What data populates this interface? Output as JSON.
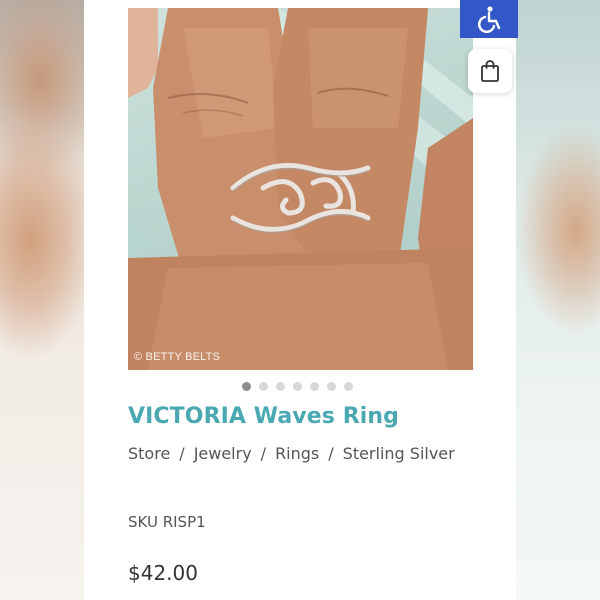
{
  "product": {
    "title": "VICTORIA Waves Ring",
    "sku": "SKU RISP1",
    "price": "$42.00",
    "image_watermark": "© BETTY BELTS",
    "image_dots": {
      "total": 7,
      "active_index": 0
    }
  },
  "breadcrumb": {
    "items": [
      "Store",
      "Jewelry",
      "Rings",
      "Sterling Silver"
    ],
    "separator": "/"
  },
  "controls": {
    "accessibility_icon": "wheelchair-icon",
    "cart_icon": "shopping-bag-icon"
  },
  "colors": {
    "title": "#4aa8b3",
    "accessibility_button": "#3457c8",
    "active_dot": "#8c8c8c",
    "inactive_dot": "#d7d7d7"
  }
}
